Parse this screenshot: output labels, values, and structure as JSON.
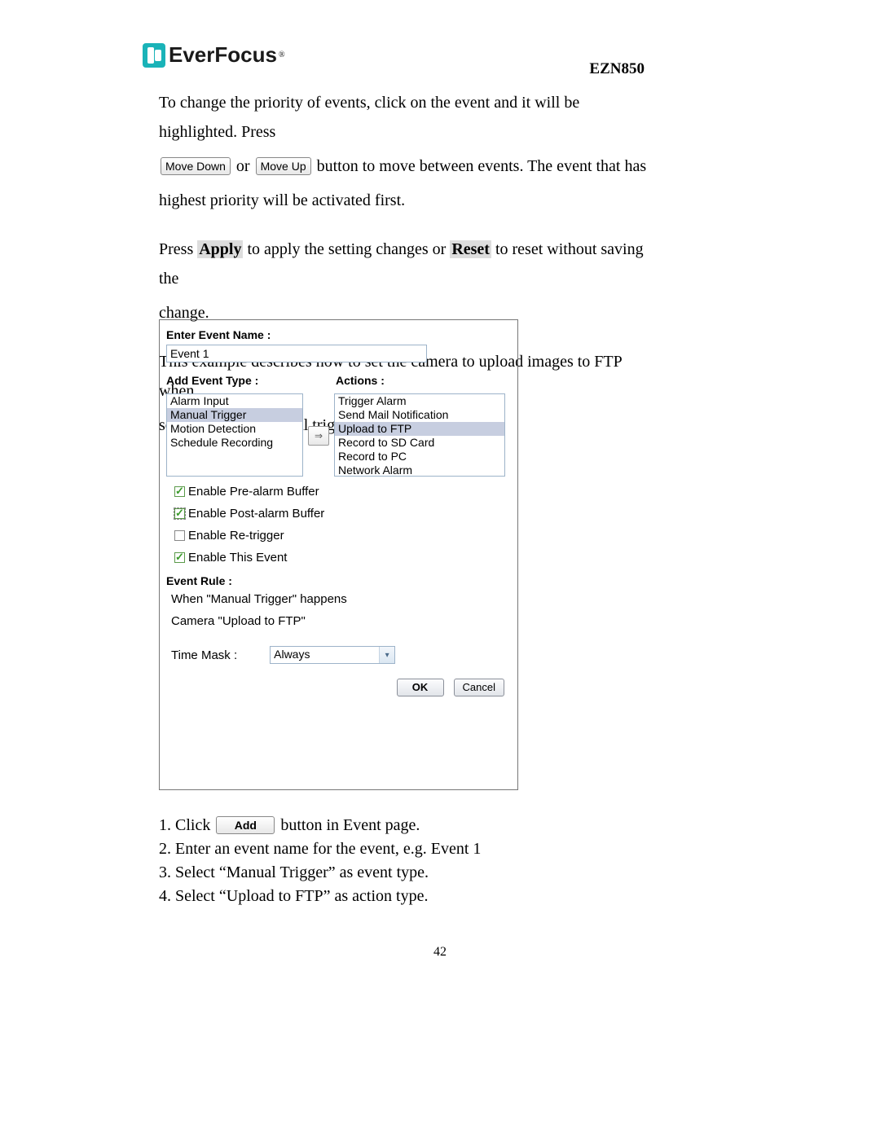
{
  "header": {
    "brand": "EverFocus",
    "brand_reg": "®",
    "model": "EZN850"
  },
  "text": {
    "p1_a": "To change the priority of events, click on the event and it will be highlighted. Press",
    "btn_move_down": "Move Down",
    "p1_or": " or ",
    "btn_move_up": "Move Up",
    "p1_b": " button to move between events. The event that has",
    "p1_c": "highest priority will be activated first.",
    "p2_a": "Press ",
    "apply": "Apply",
    "p2_b": " to apply the setting changes or ",
    "reset": "Reset",
    "p2_c": " to reset without saving the",
    "p2_d": "change.",
    "p3_a": "This example describes how to set the camera to upload images to FTP when",
    "p3_b": "someone press Manual trigger button:"
  },
  "dialog": {
    "enter_label": "Enter Event Name :",
    "event_name": "Event 1",
    "add_type_label": "Add Event Type :",
    "actions_label": "Actions :",
    "types": [
      "Alarm Input",
      "Manual Trigger",
      "Motion Detection",
      "Schedule Recording"
    ],
    "types_selected": "Manual Trigger",
    "arrow": "⇒",
    "actions": [
      "Trigger Alarm",
      "Send Mail Notification",
      "Upload to FTP",
      "Record to SD Card",
      "Record to PC",
      "Network Alarm"
    ],
    "actions_selected": "Upload to FTP",
    "chk1": "Enable Pre-alarm Buffer",
    "chk2": "Enable Post-alarm Buffer",
    "chk3": "Enable Re-trigger",
    "chk4": "Enable This Event",
    "rule_label": "Event Rule :",
    "rule_l1": "When \"Manual Trigger\" happens",
    "rule_l2": "Camera \"Upload to FTP\"",
    "mask_label": "Time Mask :",
    "mask_value": "Always",
    "ok": "OK",
    "cancel": "Cancel"
  },
  "steps": {
    "s1a": "1. Click ",
    "add_btn": "Add",
    "s1b": " button in Event page.",
    "s2": "2. Enter an event name for the event, e.g. Event 1",
    "s3": "3. Select “Manual Trigger” as event type.",
    "s4": "4. Select “Upload to FTP” as action type."
  },
  "page_number": "42"
}
